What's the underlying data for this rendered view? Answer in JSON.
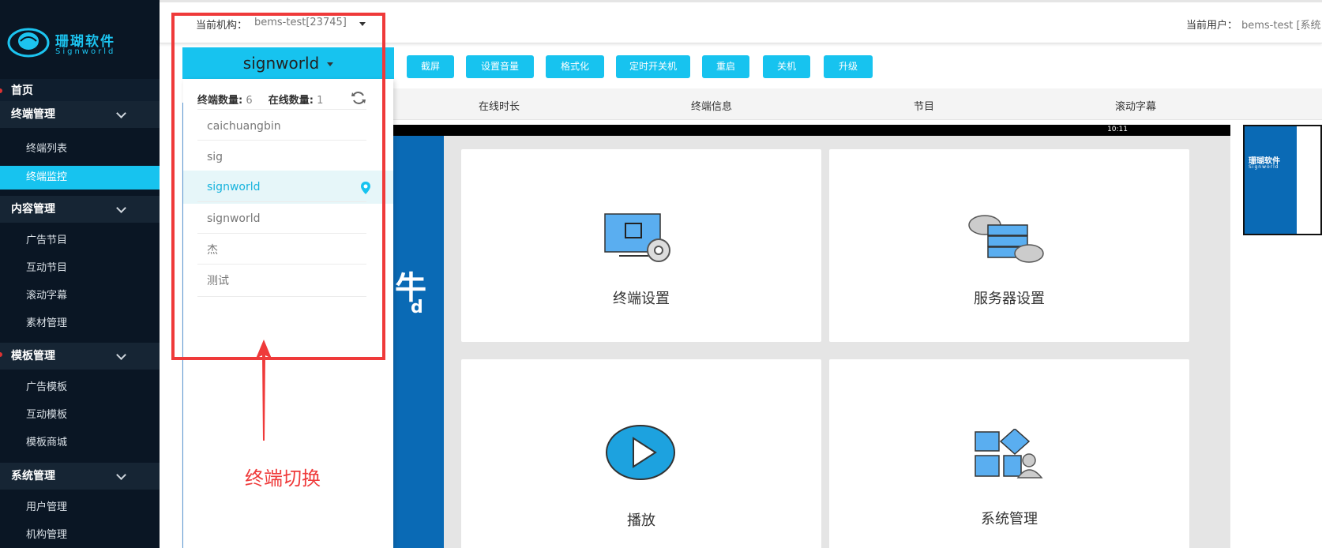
{
  "brand": {
    "name_cn": "珊瑚软件",
    "name_en": "Signworld"
  },
  "sidebar": {
    "home": "首页",
    "groups": [
      {
        "label": "终端管理",
        "items": [
          "终端列表",
          "终端监控"
        ]
      },
      {
        "label": "内容管理",
        "items": [
          "广告节目",
          "互动节目",
          "滚动字幕",
          "素材管理"
        ]
      },
      {
        "label": "模板管理",
        "items": [
          "广告模板",
          "互动模板",
          "模板商城"
        ]
      },
      {
        "label": "系统管理",
        "items": [
          "用户管理",
          "机构管理"
        ]
      }
    ],
    "active_item": "终端监控"
  },
  "topbar": {
    "org_label": "当前机构：",
    "org_value": "bems-test[23745]",
    "user_label": "当前用户：",
    "user_value": "bems-test [系统"
  },
  "actions": [
    "截屏",
    "设置音量",
    "格式化",
    "定时开关机",
    "重启",
    "关机",
    "升级"
  ],
  "table_headers": [
    "在线时长",
    "终端信息",
    "节目",
    "滚动字幕"
  ],
  "terminal_selector": {
    "selected": "signworld",
    "count_label": "终端数量:",
    "count_value": "6",
    "online_label": "在线数量:",
    "online_value": "1",
    "items": [
      "caichuangbin",
      "sig",
      "signworld",
      "signworld",
      "杰",
      "测试"
    ],
    "active_index": 2
  },
  "screen": {
    "status_time": "10:11",
    "tiles": [
      "终端设置",
      "服务器设置",
      "播放",
      "系统管理"
    ]
  },
  "annotation": {
    "text": "终端切换",
    "color": "#ef3a3a"
  },
  "colors": {
    "accent": "#17c3ef",
    "sidebar_bg": "#0a1624",
    "screen_blue": "#0a6ab5"
  }
}
